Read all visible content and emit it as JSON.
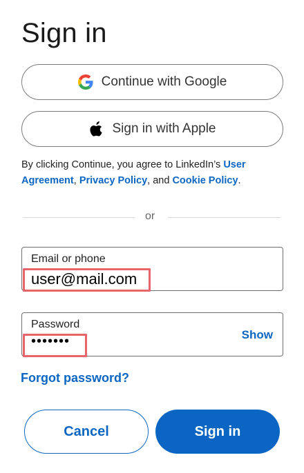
{
  "header": {
    "title": "Sign in"
  },
  "oauth": {
    "google_label": "Continue with Google",
    "apple_label": "Sign in with Apple"
  },
  "legal": {
    "prefix": "By clicking Continue, you agree to LinkedIn’s ",
    "user_agreement": "User Agreement",
    "sep1": ", ",
    "privacy_policy": "Privacy Policy",
    "sep2": ", and ",
    "cookie_policy": "Cookie Policy",
    "suffix": "."
  },
  "divider": {
    "text": "or"
  },
  "form": {
    "email": {
      "label": "Email or phone",
      "value": "user@mail.com"
    },
    "password": {
      "label": "Password",
      "value": "•••••••",
      "show_label": "Show"
    },
    "forgot_label": "Forgot password?"
  },
  "actions": {
    "cancel_label": "Cancel",
    "signin_label": "Sign in"
  },
  "colors": {
    "accent": "#0a66c2",
    "highlight": "#e8646b"
  },
  "icons": {
    "google": "google-logo-icon",
    "apple": "apple-logo-icon"
  }
}
